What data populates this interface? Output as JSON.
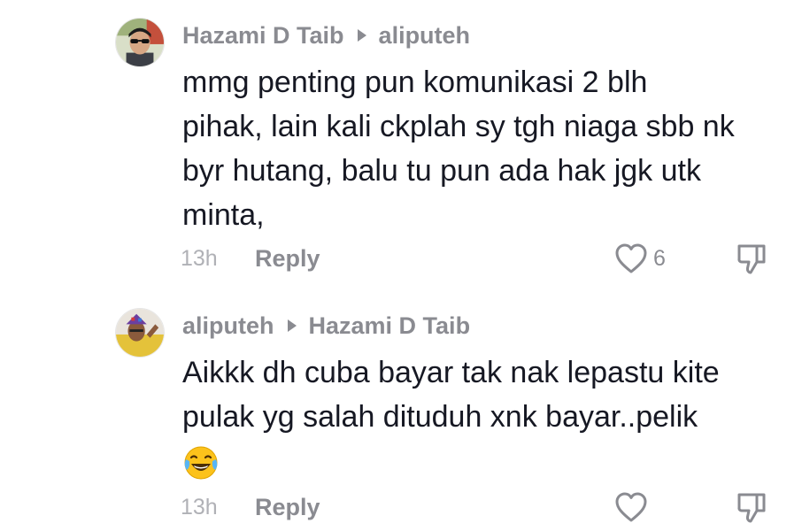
{
  "comments": [
    {
      "author": "Hazami D Taib",
      "reply_to": "aliputeh",
      "lines": [
        "mmg penting pun komunikasi 2 blh",
        "pihak, lain kali ckplah sy tgh niaga sbb nk",
        "byr hutang, balu tu pun ada hak jgk utk",
        "minta,"
      ],
      "time": "13h",
      "reply_label": "Reply",
      "likes": "6"
    },
    {
      "author": "aliputeh",
      "reply_to": "Hazami D Taib",
      "lines": [
        "Aikkk dh cuba bayar tak nak lepastu kite",
        "pulak yg salah dituduh xnk bayar..pelik"
      ],
      "emoji": "face-with-tears-of-joy",
      "time": "13h",
      "reply_label": "Reply"
    }
  ],
  "icons": {
    "reply_arrow": "play-triangle-icon",
    "like": "heart-outline-icon",
    "dislike": "thumbs-down-outline-icon"
  },
  "colors": {
    "text": "#161823",
    "muted": "#8a8b91",
    "time": "#b0b1b6"
  }
}
